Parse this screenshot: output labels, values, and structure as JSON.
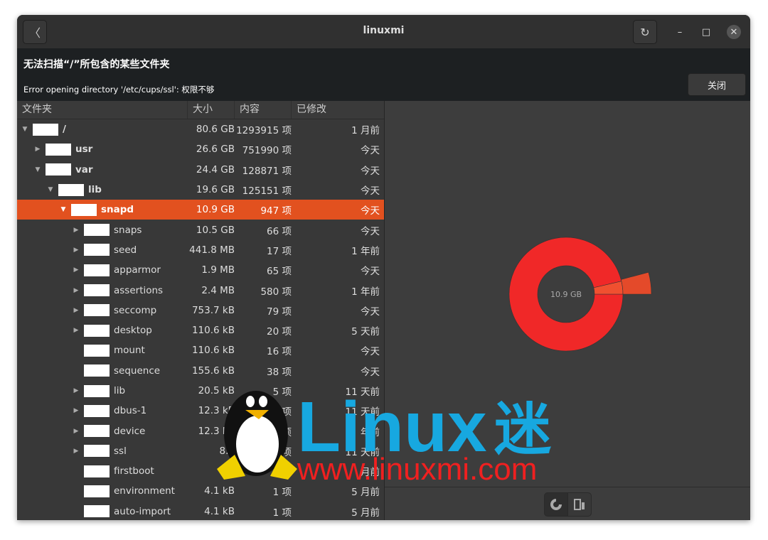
{
  "window": {
    "title": "linuxmi"
  },
  "info": {
    "heading": "无法扫描“/”所包含的某些文件夹",
    "message": "Error opening directory '/etc/cups/ssl': 权限不够",
    "close_label": "关闭"
  },
  "columns": [
    "文件夹",
    "大小",
    "内容",
    "已修改"
  ],
  "rows": [
    {
      "name": "/",
      "size": "80.6 GB",
      "count": "1293915 项",
      "modified": "1 月前",
      "depth": 0,
      "expander": "expanded",
      "bold": true
    },
    {
      "name": "usr",
      "size": "26.6 GB",
      "count": "751990 项",
      "modified": "今天",
      "depth": 1,
      "expander": "collapsed",
      "bold": true
    },
    {
      "name": "var",
      "size": "24.4 GB",
      "count": "128871 项",
      "modified": "今天",
      "depth": 1,
      "expander": "expanded",
      "bold": true
    },
    {
      "name": "lib",
      "size": "19.6 GB",
      "count": "125151 项",
      "modified": "今天",
      "depth": 2,
      "expander": "expanded",
      "bold": true
    },
    {
      "name": "snapd",
      "size": "10.9 GB",
      "count": "947 项",
      "modified": "今天",
      "depth": 3,
      "expander": "expanded",
      "bold": true,
      "selected": true
    },
    {
      "name": "snaps",
      "size": "10.5 GB",
      "count": "66 项",
      "modified": "今天",
      "depth": 4,
      "expander": "collapsed"
    },
    {
      "name": "seed",
      "size": "441.8 MB",
      "count": "17 项",
      "modified": "1 年前",
      "depth": 4,
      "expander": "collapsed"
    },
    {
      "name": "apparmor",
      "size": "1.9 MB",
      "count": "65 项",
      "modified": "今天",
      "depth": 4,
      "expander": "collapsed"
    },
    {
      "name": "assertions",
      "size": "2.4 MB",
      "count": "580 项",
      "modified": "1 年前",
      "depth": 4,
      "expander": "collapsed"
    },
    {
      "name": "seccomp",
      "size": "753.7 kB",
      "count": "79 项",
      "modified": "今天",
      "depth": 4,
      "expander": "collapsed"
    },
    {
      "name": "desktop",
      "size": "110.6 kB",
      "count": "20 项",
      "modified": "5 天前",
      "depth": 4,
      "expander": "collapsed"
    },
    {
      "name": "mount",
      "size": "110.6 kB",
      "count": "16 项",
      "modified": "今天",
      "depth": 4,
      "expander": "none"
    },
    {
      "name": "sequence",
      "size": "155.6 kB",
      "count": "38 项",
      "modified": "今天",
      "depth": 4,
      "expander": "none"
    },
    {
      "name": "lib",
      "size": "20.5 kB",
      "count": "5 项",
      "modified": "11 天前",
      "depth": 4,
      "expander": "collapsed"
    },
    {
      "name": "dbus-1",
      "size": "12.3 kB",
      "count": "3 项",
      "modified": "11 天前",
      "depth": 4,
      "expander": "collapsed"
    },
    {
      "name": "device",
      "size": "12.3 kB",
      "count": "项",
      "modified": "年前",
      "depth": 4,
      "expander": "collapsed"
    },
    {
      "name": "ssl",
      "size": "8.2",
      "count": "项",
      "modified": "11 天前",
      "depth": 4,
      "expander": "collapsed"
    },
    {
      "name": "firstboot",
      "size": "4.1",
      "count": "",
      "modified": "月前",
      "depth": 4,
      "expander": "none"
    },
    {
      "name": "environment",
      "size": "4.1 kB",
      "count": "1 项",
      "modified": "5 月前",
      "depth": 4,
      "expander": "none"
    },
    {
      "name": "auto-import",
      "size": "4.1 kB",
      "count": "1 项",
      "modified": "5 月前",
      "depth": 4,
      "expander": "none"
    }
  ],
  "chart": {
    "center_label": "10.9 GB",
    "colors": {
      "main": "#f02828",
      "sub": "#f05030",
      "outer": "#e44a2a"
    }
  },
  "view_buttons": [
    {
      "icon": "ring-chart-icon",
      "active": true
    },
    {
      "icon": "treemap-icon",
      "active": false
    }
  ],
  "watermark": {
    "text": "Linux迷",
    "url": "www.linuxmi.com"
  }
}
